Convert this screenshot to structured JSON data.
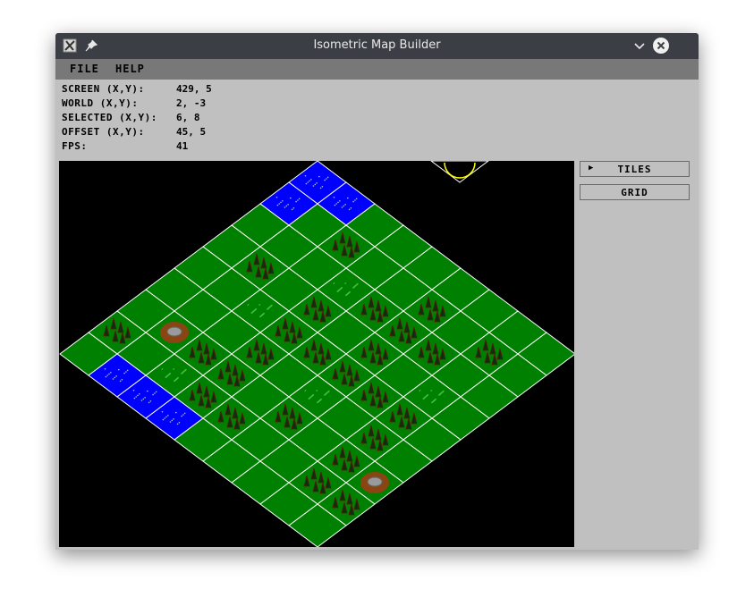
{
  "window": {
    "title": "Isometric Map Builder"
  },
  "titlebar": {
    "app_icon": "tools-icon",
    "pin_icon": "pin-icon",
    "minimize_icon": "chevron-down-icon",
    "close_icon": "close-icon"
  },
  "menu": {
    "items": [
      "FILE",
      "HELP"
    ]
  },
  "info": {
    "screen_label": "SCREEN (X,Y):",
    "screen_value": "429, 5",
    "world_label": "WORLD (X,Y):",
    "world_value": "2, -3",
    "selected_label": "SELECTED (X,Y):",
    "selected_value": "6, 8",
    "offset_label": "OFFSET (X,Y):",
    "offset_value": "45, 5",
    "fps_label": "FPS:",
    "fps_value": "41"
  },
  "side_panel": {
    "tiles_label": "TILES",
    "grid_label": "GRID",
    "tiles_icon": "triangle-right-icon"
  },
  "map": {
    "size": [
      9,
      9
    ],
    "colors": {
      "grass": "#008000",
      "water": "#0000ff",
      "grid": "#ffffff",
      "tree": "#5a1a10",
      "dirt": "#8b4513"
    },
    "rows": [
      "WWGGGGGGG",
      "WGTGGTGTG",
      "GGGFTTTGG",
      "GTGTGTGFG",
      "GGFTTTTTG",
      "GGGTGFGTG",
      "GMTTGTGTM",
      "TGFTTGGTT",
      "GWWWGGGGG"
    ],
    "legend": {
      "W": "water",
      "G": "grass",
      "T": "trees",
      "F": "flowers",
      "M": "rock"
    }
  }
}
